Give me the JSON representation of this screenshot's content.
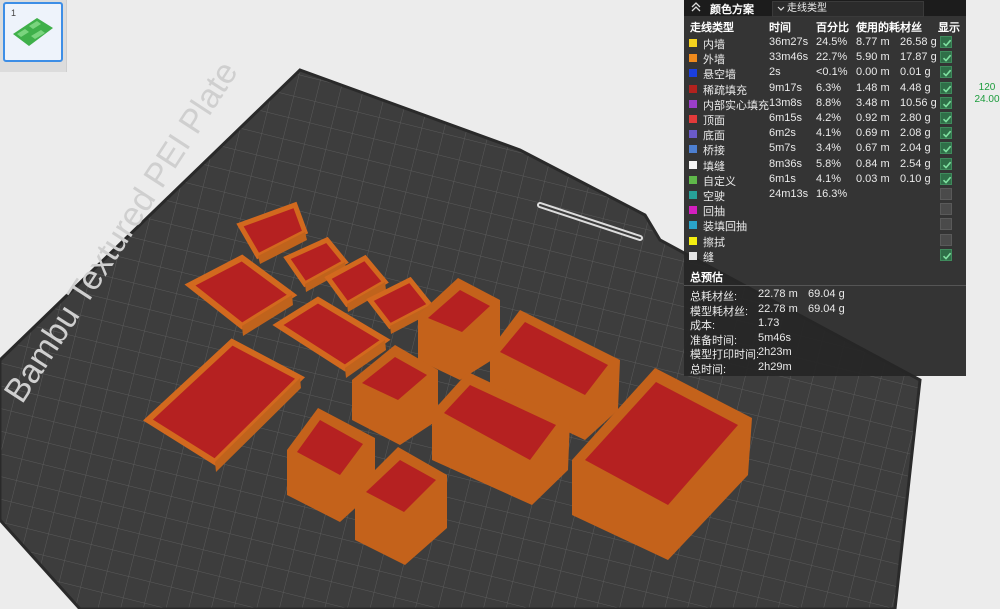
{
  "thumbnail": {
    "index": "1"
  },
  "plate": {
    "label": "Bambu Textured PEI Plate"
  },
  "legend": {
    "scheme_title": "颜色方案",
    "scheme_value": "走线类型",
    "headers": {
      "type": "走线类型",
      "time": "时间",
      "percent": "百分比",
      "filament": "使用的耗材丝",
      "show": "显示"
    },
    "rows": [
      {
        "name": "内墙",
        "color": "#f4d21e",
        "time": "36m27s",
        "percent": "24.5%",
        "m": "8.77 m",
        "g": "26.58 g",
        "show": true
      },
      {
        "name": "外墙",
        "color": "#ef8a1c",
        "time": "33m46s",
        "percent": "22.7%",
        "m": "5.90 m",
        "g": "17.87 g",
        "show": true
      },
      {
        "name": "悬空墙",
        "color": "#1a3fe0",
        "time": "2s",
        "percent": "<0.1%",
        "m": "0.00 m",
        "g": "0.01 g",
        "show": true
      },
      {
        "name": "稀疏填充",
        "color": "#b2221e",
        "time": "9m17s",
        "percent": "6.3%",
        "m": "1.48 m",
        "g": "4.48 g",
        "show": true
      },
      {
        "name": "内部实心填充",
        "color": "#9b3ec8",
        "time": "13m8s",
        "percent": "8.8%",
        "m": "3.48 m",
        "g": "10.56 g",
        "show": true
      },
      {
        "name": "顶面",
        "color": "#e23a3a",
        "time": "6m15s",
        "percent": "4.2%",
        "m": "0.92 m",
        "g": "2.80 g",
        "show": true
      },
      {
        "name": "底面",
        "color": "#6a5ac8",
        "time": "6m2s",
        "percent": "4.1%",
        "m": "0.69 m",
        "g": "2.08 g",
        "show": true
      },
      {
        "name": "桥接",
        "color": "#4d7fd0",
        "time": "5m7s",
        "percent": "3.4%",
        "m": "0.67 m",
        "g": "2.04 g",
        "show": true
      },
      {
        "name": "填缝",
        "color": "#f5f5f5",
        "time": "8m36s",
        "percent": "5.8%",
        "m": "0.84 m",
        "g": "2.54 g",
        "show": true
      },
      {
        "name": "自定义",
        "color": "#5fb84a",
        "time": "6m1s",
        "percent": "4.1%",
        "m": "0.03 m",
        "g": "0.10 g",
        "show": true
      },
      {
        "name": "空驶",
        "color": "#27a098",
        "time": "24m13s",
        "percent": "16.3%",
        "m": "",
        "g": "",
        "show": false
      },
      {
        "name": "回抽",
        "color": "#d41fbf",
        "time": "",
        "percent": "",
        "m": "",
        "g": "",
        "show": false
      },
      {
        "name": "装填回抽",
        "color": "#2aa3c8",
        "time": "",
        "percent": "",
        "m": "",
        "g": "",
        "show": false
      },
      {
        "name": "擦拭",
        "color": "#f4ee10",
        "time": "",
        "percent": "",
        "m": "",
        "g": "",
        "show": false
      },
      {
        "name": "缝",
        "color": "#e6e6e6",
        "time": "",
        "percent": "",
        "m": "",
        "g": "",
        "show": true
      }
    ]
  },
  "summary": {
    "title": "总预估",
    "rows": [
      {
        "label": "总耗材丝:",
        "v1": "22.78 m",
        "v2": "69.04 g"
      },
      {
        "label": "模型耗材丝:",
        "v1": "22.78 m",
        "v2": "69.04 g"
      },
      {
        "label": "成本:",
        "v1": "1.73",
        "v2": ""
      },
      {
        "label": "准备时间:",
        "v1": "5m46s",
        "v2": ""
      },
      {
        "label": "模型打印时间:",
        "v1": "2h23m",
        "v2": ""
      },
      {
        "label": "总时间:",
        "v1": "2h29m",
        "v2": ""
      }
    ]
  },
  "layer_slider": {
    "layer": "120",
    "height": "24.00"
  }
}
